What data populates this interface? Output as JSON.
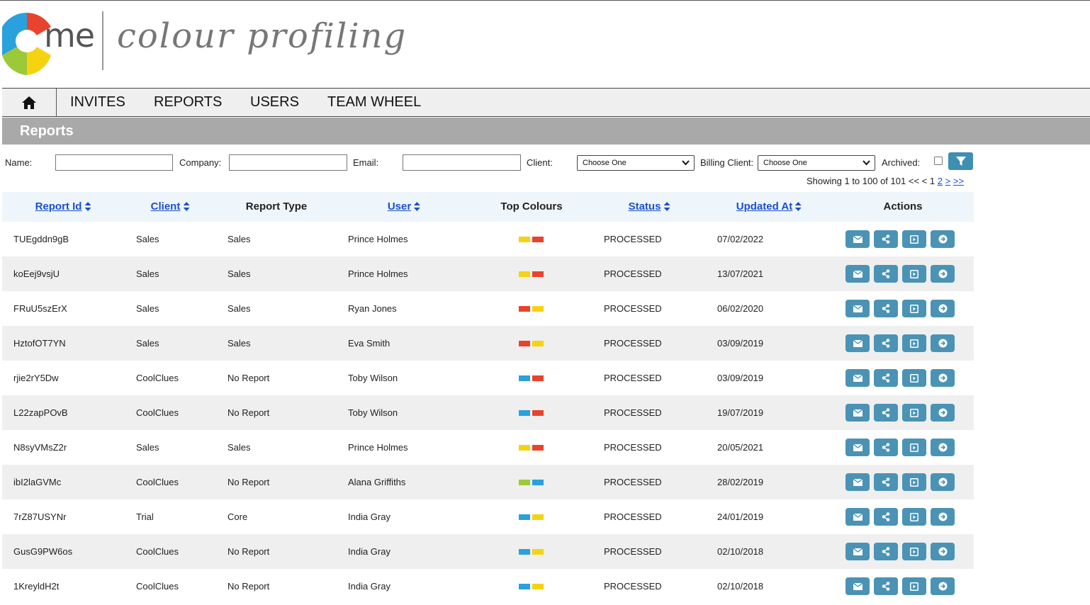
{
  "brand": {
    "logo_text": "me",
    "tagline": "colour profiling",
    "wheel_colors": [
      "#e8432d",
      "#f5d311",
      "#9cc93a",
      "#2aa0dd"
    ]
  },
  "nav": {
    "home_icon": "home-icon",
    "items": [
      {
        "label": "INVITES"
      },
      {
        "label": "REPORTS"
      },
      {
        "label": "USERS"
      },
      {
        "label": "TEAM WHEEL"
      }
    ]
  },
  "page_title": "Reports",
  "filters": {
    "name_label": "Name:",
    "name_value": "",
    "company_label": "Company:",
    "company_value": "",
    "email_label": "Email:",
    "email_value": "",
    "client_label": "Client:",
    "client_selected": "Choose One",
    "billing_label": "Billing Client:",
    "billing_selected": "Choose One",
    "archived_label": "Archived:",
    "archived_checked": false,
    "filter_icon": "filter-icon"
  },
  "paging": {
    "summary": "Showing 1 to 100 of 101",
    "first": "<<",
    "prev": "<",
    "page_1": "1",
    "page_2": "2",
    "next": ">",
    "last": ">>"
  },
  "table": {
    "headers": {
      "report_id": "Report Id",
      "client": "Client",
      "report_type": "Report Type",
      "user": "User",
      "top_colours": "Top Colours",
      "status": "Status",
      "updated_at": "Updated At",
      "actions": "Actions"
    },
    "colour_map": {
      "red": "#e8432d",
      "yellow": "#f5d311",
      "blue": "#2aa0dd",
      "green": "#9cc93a"
    },
    "action_icons": [
      "email-icon",
      "share-icon",
      "view-report-icon",
      "go-arrow-icon"
    ],
    "rows": [
      {
        "id": "TUEgddn9gB",
        "client": "Sales",
        "type": "Sales",
        "user": "Prince Holmes",
        "colours": [
          "yellow",
          "red"
        ],
        "status": "PROCESSED",
        "updated": "07/02/2022"
      },
      {
        "id": "koEej9vsjU",
        "client": "Sales",
        "type": "Sales",
        "user": "Prince Holmes",
        "colours": [
          "yellow",
          "red"
        ],
        "status": "PROCESSED",
        "updated": "13/07/2021"
      },
      {
        "id": "FRuU5szErX",
        "client": "Sales",
        "type": "Sales",
        "user": "Ryan Jones",
        "colours": [
          "red",
          "yellow"
        ],
        "status": "PROCESSED",
        "updated": "06/02/2020"
      },
      {
        "id": "HztofOT7YN",
        "client": "Sales",
        "type": "Sales",
        "user": "Eva Smith",
        "colours": [
          "red",
          "yellow"
        ],
        "status": "PROCESSED",
        "updated": "03/09/2019"
      },
      {
        "id": "rjie2rY5Dw",
        "client": "CoolClues",
        "type": "No Report",
        "user": "Toby Wilson",
        "colours": [
          "blue",
          "red"
        ],
        "status": "PROCESSED",
        "updated": "03/09/2019"
      },
      {
        "id": "L22zapPOvB",
        "client": "CoolClues",
        "type": "No Report",
        "user": "Toby Wilson",
        "colours": [
          "blue",
          "red"
        ],
        "status": "PROCESSED",
        "updated": "19/07/2019"
      },
      {
        "id": "N8syVMsZ2r",
        "client": "Sales",
        "type": "Sales",
        "user": "Prince Holmes",
        "colours": [
          "yellow",
          "red"
        ],
        "status": "PROCESSED",
        "updated": "20/05/2021"
      },
      {
        "id": "ibI2laGVMc",
        "client": "CoolClues",
        "type": "No Report",
        "user": "Alana Griffiths",
        "colours": [
          "green",
          "blue"
        ],
        "status": "PROCESSED",
        "updated": "28/02/2019"
      },
      {
        "id": "7rZ87USYNr",
        "client": "Trial",
        "type": "Core",
        "user": "India Gray",
        "colours": [
          "blue",
          "yellow"
        ],
        "status": "PROCESSED",
        "updated": "24/01/2019"
      },
      {
        "id": "GusG9PW6os",
        "client": "CoolClues",
        "type": "No Report",
        "user": "India Gray",
        "colours": [
          "blue",
          "yellow"
        ],
        "status": "PROCESSED",
        "updated": "02/10/2018"
      },
      {
        "id": "1KreyldH2t",
        "client": "CoolClues",
        "type": "No Report",
        "user": "India Gray",
        "colours": [
          "blue",
          "yellow"
        ],
        "status": "PROCESSED",
        "updated": "02/10/2018"
      }
    ]
  }
}
